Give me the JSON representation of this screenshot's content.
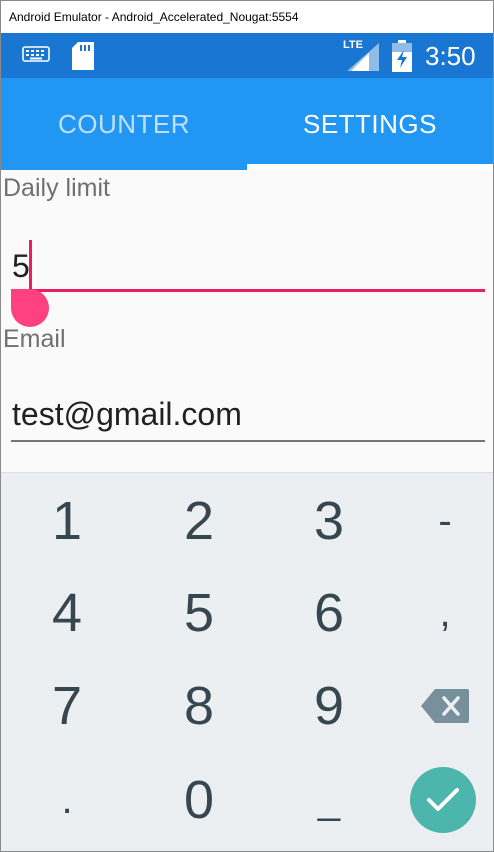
{
  "window": {
    "title": "Android Emulator - Android_Accelerated_Nougat:5554"
  },
  "status_bar": {
    "time": "3:50",
    "network": "LTE"
  },
  "tabs": [
    {
      "label": "COUNTER",
      "selected": false
    },
    {
      "label": "SETTINGS",
      "selected": true
    }
  ],
  "form": {
    "daily_limit": {
      "label": "Daily limit",
      "value": "5"
    },
    "email": {
      "label": "Email",
      "value": "test@gmail.com"
    }
  },
  "keyboard": {
    "keys": [
      "1",
      "2",
      "3",
      "-",
      "4",
      "5",
      "6",
      ",",
      "7",
      "8",
      "9",
      ".",
      "0",
      "_"
    ],
    "backspace_icon": "backspace-icon",
    "done_icon": "checkmark-icon"
  },
  "colors": {
    "status_bar": "#1976d2",
    "tab_bar": "#2196f3",
    "accent": "#e91e63",
    "done_button": "#4db6ac"
  }
}
